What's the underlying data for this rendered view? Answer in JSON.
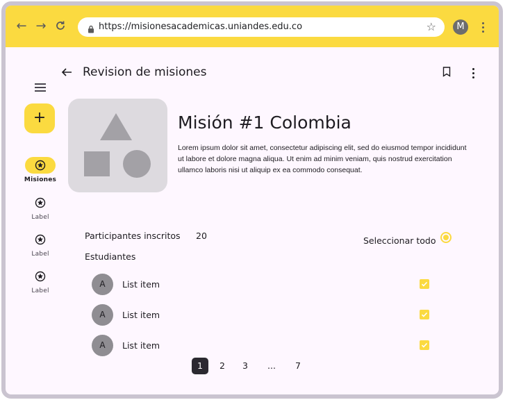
{
  "browser": {
    "url": "https://misionesacademicas.uniandes.edu.co",
    "profile_initial": "M",
    "accent_color": "#fbda40"
  },
  "nav_rail": {
    "fab_label": "+",
    "items": [
      {
        "label": "Misiones",
        "icon": "star-circle-icon",
        "active": true
      },
      {
        "label": "Label",
        "icon": "star-circle-icon",
        "active": false
      },
      {
        "label": "Label",
        "icon": "star-circle-icon",
        "active": false
      },
      {
        "label": "Label",
        "icon": "star-circle-icon",
        "active": false
      }
    ]
  },
  "app_bar": {
    "title": "Revision de misiones"
  },
  "mission": {
    "title": "Misión #1 Colombia",
    "description": "Lorem ipsum dolor sit amet, consectetur adipiscing elit, sed do eiusmod tempor incididunt ut labore et dolore magna aliqua. Ut enim ad minim veniam, quis nostrud exercitation ullamco laboris nisi ut aliquip ex ea commodo consequat."
  },
  "participants": {
    "label": "Participantes inscritos",
    "count": "20",
    "select_all_label": "Seleccionar todo",
    "students_heading": "Estudiantes",
    "items": [
      {
        "avatar": "A",
        "label": "List item",
        "checked": true
      },
      {
        "avatar": "A",
        "label": "List item",
        "checked": true
      },
      {
        "avatar": "A",
        "label": "List item",
        "checked": true
      }
    ]
  },
  "pagination": {
    "pages": [
      "1",
      "2",
      "3",
      "...",
      "7"
    ],
    "current": "1"
  }
}
